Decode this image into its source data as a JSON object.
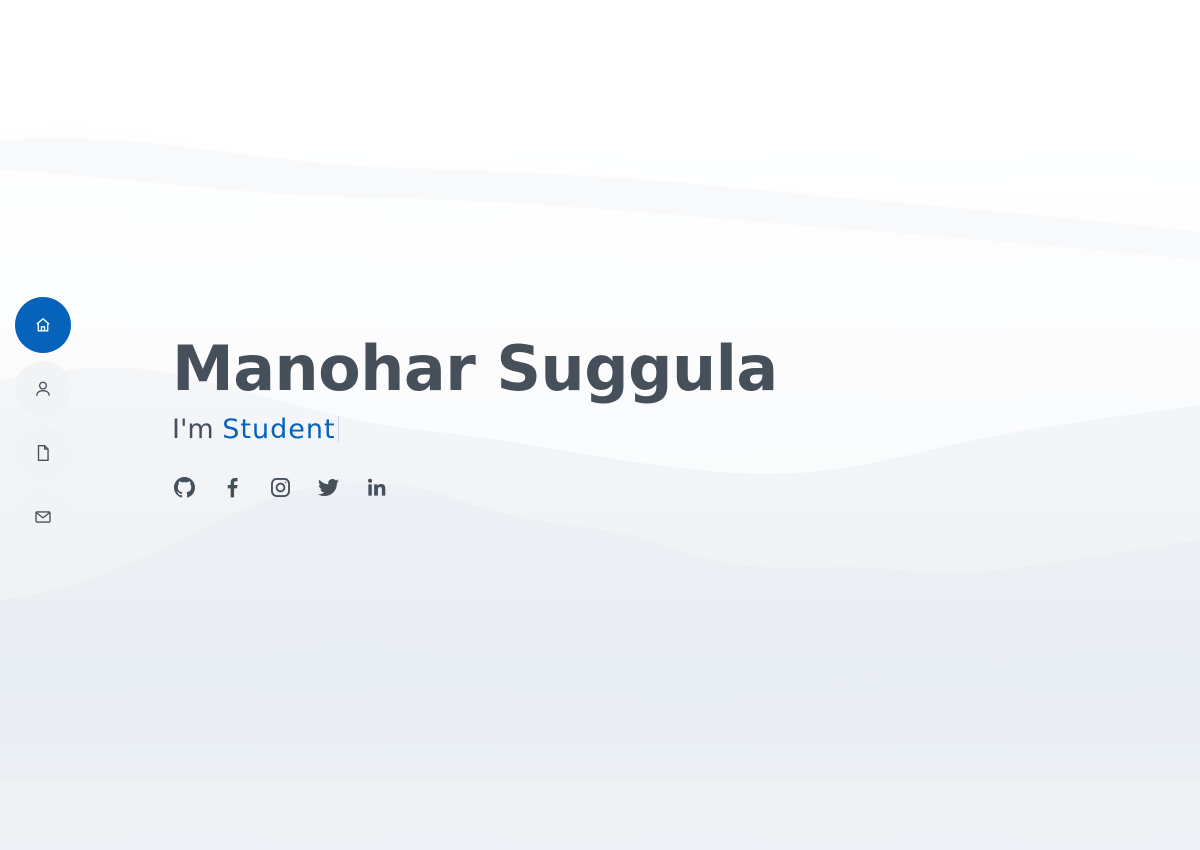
{
  "hero": {
    "name": "Manohar Suggula",
    "prefix": "I'm",
    "typed_text": "Student"
  },
  "nav": {
    "items": [
      {
        "icon": "house-icon",
        "active": true
      },
      {
        "icon": "person-icon",
        "active": false
      },
      {
        "icon": "file-icon",
        "active": false
      },
      {
        "icon": "envelope-icon",
        "active": false
      }
    ]
  },
  "socials": [
    {
      "icon": "github-icon"
    },
    {
      "icon": "facebook-icon"
    },
    {
      "icon": "instagram-icon"
    },
    {
      "icon": "twitter-icon"
    },
    {
      "icon": "linkedin-icon"
    }
  ],
  "colors": {
    "accent": "#0563bb",
    "heading": "#45505b",
    "nav_bg": "#f2f3f5",
    "background": "#ffffff"
  }
}
